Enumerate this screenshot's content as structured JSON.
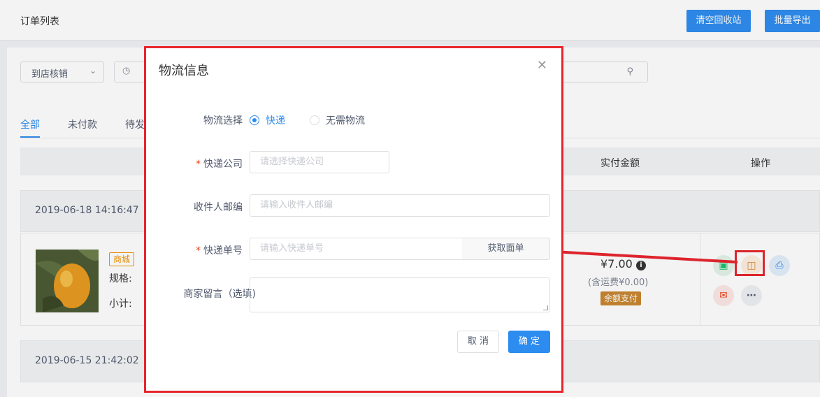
{
  "header": {
    "title": "订单列表",
    "clear_recycle_label": "清空回收站",
    "batch_export_label": "批量导出"
  },
  "filters": {
    "type_select_value": "到店核销"
  },
  "tabs": [
    "全部",
    "未付款",
    "待发"
  ],
  "table_headers": {
    "paid_amount": "实付金额",
    "actions": "操作"
  },
  "orders": [
    {
      "time": "2019-06-18 14:16:47",
      "mall_tag": "商城",
      "spec_label": "规格:",
      "subtotal_label": "小计:",
      "price": "¥7.00",
      "freight": "(含运费¥0.00)",
      "pay_method": "余额支付"
    },
    {
      "time": "2019-06-15 21:42:02"
    }
  ],
  "modal": {
    "title": "物流信息",
    "logistics_label": "物流选择",
    "option_express": "快递",
    "option_none": "无需物流",
    "company_label": "快递公司",
    "company_placeholder": "请选择快递公司",
    "zip_label": "收件人邮编",
    "zip_placeholder": "请输入收件人邮编",
    "tracking_label": "快递单号",
    "tracking_placeholder": "请输入快递单号",
    "get_waybill_label": "获取面单",
    "remark_label": "商家留言（选填)",
    "cancel_label": "取 消",
    "ok_label": "确 定"
  },
  "colors": {
    "primary": "#2d8cf0",
    "highlight_red": "#e8242c",
    "required": "#ed4014"
  }
}
